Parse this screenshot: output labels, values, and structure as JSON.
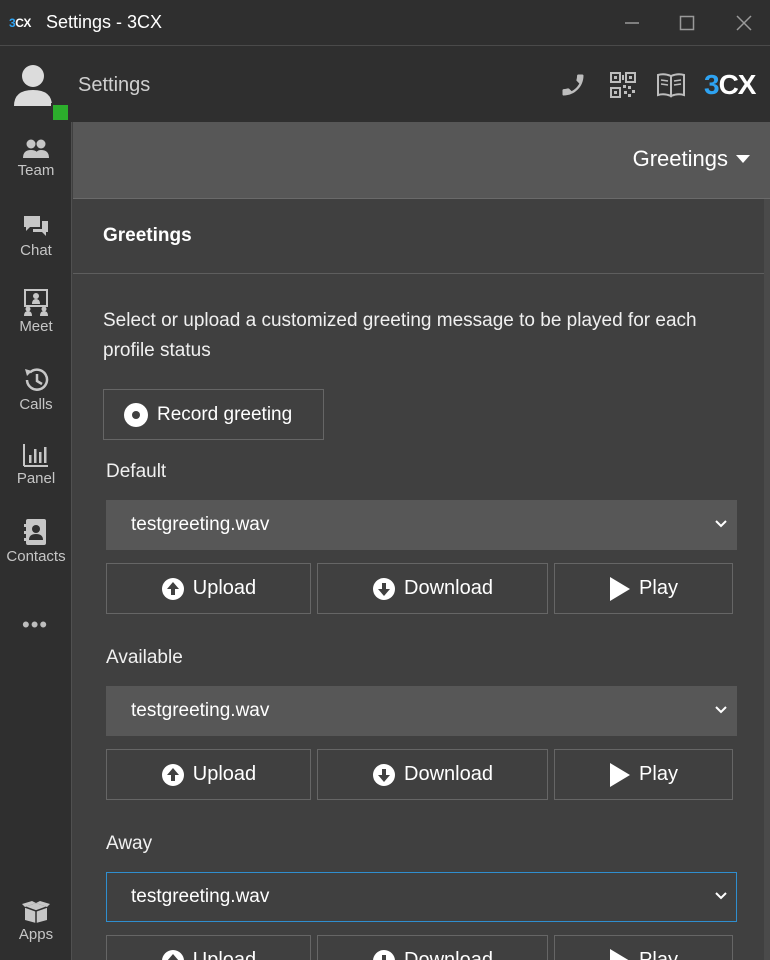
{
  "window": {
    "logo_prefix": "3",
    "logo_suffix": "CX",
    "title": "Settings - 3CX",
    "minimize_icon": "minimize-icon",
    "maximize_icon": "maximize-icon",
    "close_icon": "close-icon"
  },
  "header": {
    "title": "Settings",
    "status_color": "#2cae2c",
    "brand_prefix": "3",
    "brand_suffix": "CX",
    "icons": [
      "phone-icon",
      "qr-code-icon",
      "book-icon"
    ]
  },
  "sidebar": {
    "items": [
      {
        "label": "Team",
        "icon": "team-icon"
      },
      {
        "label": "Chat",
        "icon": "chat-icon"
      },
      {
        "label": "Meet",
        "icon": "meet-icon"
      },
      {
        "label": "Calls",
        "icon": "calls-history-icon"
      },
      {
        "label": "Panel",
        "icon": "panel-icon"
      },
      {
        "label": "Contacts",
        "icon": "contacts-icon"
      }
    ],
    "more": "•••",
    "apps_label": "Apps"
  },
  "section": {
    "selected": "Greetings"
  },
  "content": {
    "title": "Greetings",
    "description": "Select or upload a customized greeting message to be played for each profile status",
    "record_label": "Record greeting",
    "groups": [
      {
        "label": "Default",
        "file": "testgreeting.wav"
      },
      {
        "label": "Available",
        "file": "testgreeting.wav"
      },
      {
        "label": "Away",
        "file": "testgreeting.wav"
      }
    ],
    "upload_label": "Upload",
    "download_label": "Download",
    "play_label": "Play"
  },
  "colors": {
    "accent": "#2ea3f2",
    "focus_border": "#2f8ecf",
    "background": "#404040",
    "chrome": "#2f2f2f"
  }
}
